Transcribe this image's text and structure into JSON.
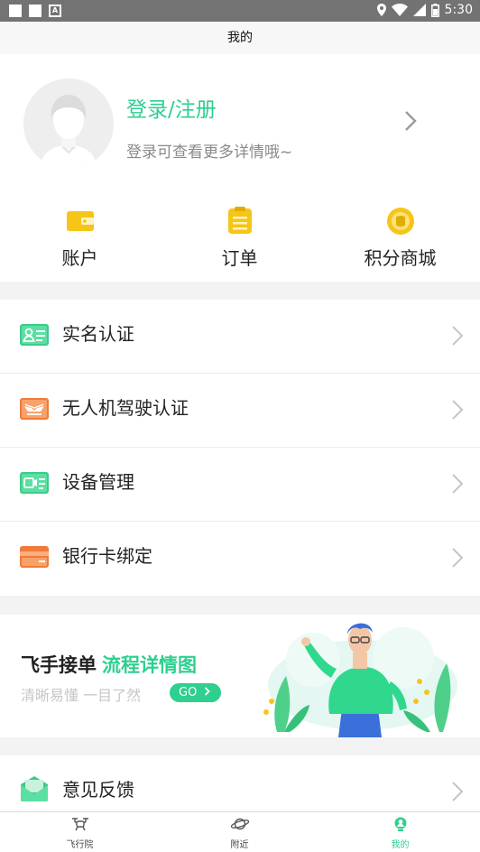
{
  "status_bar": {
    "time": "5:30",
    "indicator": "A"
  },
  "header": {
    "title": "我的"
  },
  "profile": {
    "login_title": "登录/注册",
    "login_subtitle": "登录可查看更多详情哦~"
  },
  "quick_actions": [
    {
      "label": "账户",
      "icon": "wallet-icon"
    },
    {
      "label": "订单",
      "icon": "order-list-icon"
    },
    {
      "label": "积分商城",
      "icon": "coins-icon"
    }
  ],
  "menu": [
    {
      "label": "实名认证",
      "icon": "id-card-icon"
    },
    {
      "label": "无人机驾驶认证",
      "icon": "drone-license-icon"
    },
    {
      "label": "设备管理",
      "icon": "device-icon"
    },
    {
      "label": "银行卡绑定",
      "icon": "bank-card-icon"
    }
  ],
  "banner": {
    "title": "飞手接单",
    "title_highlight": "流程详情图",
    "subtitle": "清晰易懂 一目了然",
    "button": "GO"
  },
  "feedback": {
    "label": "意见反馈",
    "icon": "feedback-mail-icon"
  },
  "tab_bar": [
    {
      "label": "飞行院",
      "icon": "drone-icon"
    },
    {
      "label": "附近",
      "icon": "planet-icon"
    },
    {
      "label": "我的",
      "icon": "user-pin-icon",
      "active": true
    }
  ],
  "colors": {
    "accent": "#2fcf8f",
    "icon_yellow": "#f5c518",
    "icon_orange": "#f07a3a",
    "status_bar": "#737373"
  }
}
